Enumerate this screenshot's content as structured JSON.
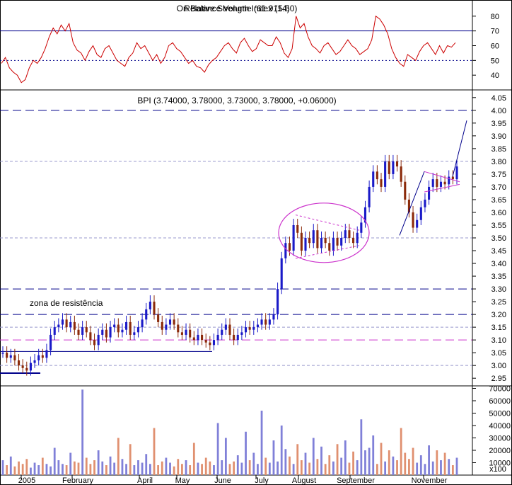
{
  "chart_data": [
    {
      "type": "line",
      "title": "Relative Strength Index (14)",
      "overlay_title": "On Balance Volume (61.915.50)",
      "ylim": [
        30,
        90
      ],
      "yticks": [
        "40",
        "50",
        "60",
        "70",
        "80"
      ],
      "reference_lines": {
        "overbought": 70,
        "oversold": 30,
        "middle": 50
      },
      "series": [
        {
          "values": [
            48,
            52,
            45,
            42,
            40,
            35,
            37,
            45,
            50,
            48,
            52,
            58,
            66,
            72,
            68,
            74,
            70,
            75,
            62,
            57,
            55,
            50,
            56,
            60,
            54,
            52,
            58,
            60,
            55,
            50,
            48,
            46,
            52,
            55,
            62,
            58,
            60,
            55,
            50,
            54,
            48,
            52,
            60,
            62,
            58,
            56,
            52,
            48,
            50,
            46,
            45,
            42,
            47,
            50,
            52,
            56,
            60,
            62,
            58,
            55,
            62,
            65,
            60,
            56,
            58,
            64,
            62,
            60,
            60,
            66,
            62,
            55,
            52,
            58,
            80,
            72,
            75,
            66,
            60,
            58,
            55,
            60,
            62,
            58,
            54,
            56,
            60,
            64,
            60,
            58,
            54,
            56,
            58,
            64,
            80,
            78,
            74,
            68,
            58,
            52,
            48,
            46,
            54,
            52,
            50,
            56,
            60,
            62,
            58,
            54,
            60,
            55,
            60,
            59,
            62
          ]
        }
      ]
    },
    {
      "type": "candlestick",
      "title": "BPI (3.74000, 3.78000, 3.73000, 3.78000, +0.06000)",
      "ylim": [
        2.92,
        4.08
      ],
      "yticks": [
        "2.95",
        "3.00",
        "3.05",
        "3.10",
        "3.15",
        "3.20",
        "3.25",
        "3.30",
        "3.35",
        "3.40",
        "3.45",
        "3.50",
        "3.55",
        "3.60",
        "3.65",
        "3.70",
        "3.75",
        "3.80",
        "3.85",
        "3.90",
        "3.95",
        "4.00",
        "4.05"
      ],
      "annotation": "zona de resistência",
      "colors": {
        "up": "#1a1ac8",
        "down": "#8b2a0a",
        "rsi": "#cc0000",
        "pattern": "#cc33cc",
        "guide": "#00008b"
      },
      "support_resistance_levels": [
        4.0,
        3.3,
        3.2,
        3.1
      ],
      "dotted_levels": [
        3.8,
        3.5,
        3.15,
        3.0
      ],
      "close": [
        3.05,
        3.03,
        3.04,
        3.02,
        3.0,
        2.99,
        2.98,
        3.01,
        3.02,
        3.04,
        3.03,
        3.06,
        3.12,
        3.15,
        3.16,
        3.18,
        3.15,
        3.17,
        3.14,
        3.12,
        3.15,
        3.13,
        3.1,
        3.08,
        3.12,
        3.14,
        3.11,
        3.15,
        3.16,
        3.13,
        3.14,
        3.17,
        3.12,
        3.13,
        3.15,
        3.18,
        3.22,
        3.25,
        3.2,
        3.17,
        3.14,
        3.16,
        3.18,
        3.16,
        3.13,
        3.12,
        3.14,
        3.11,
        3.1,
        3.12,
        3.1,
        3.09,
        3.08,
        3.1,
        3.12,
        3.14,
        3.16,
        3.12,
        3.1,
        3.12,
        3.13,
        3.15,
        3.14,
        3.15,
        3.16,
        3.18,
        3.16,
        3.18,
        3.2,
        3.3,
        3.42,
        3.48,
        3.45,
        3.55,
        3.52,
        3.45,
        3.5,
        3.48,
        3.53,
        3.46,
        3.5,
        3.48,
        3.45,
        3.5,
        3.47,
        3.5,
        3.53,
        3.5,
        3.48,
        3.52,
        3.56,
        3.62,
        3.7,
        3.76,
        3.73,
        3.7,
        3.8,
        3.75,
        3.8,
        3.78,
        3.72,
        3.65,
        3.6,
        3.54,
        3.57,
        3.62,
        3.65,
        3.7,
        3.73,
        3.7,
        3.72,
        3.71,
        3.74,
        3.73,
        3.78
      ],
      "high_low_ranges": [
        [
          3.02,
          3.08
        ],
        [
          2.98,
          3.1
        ]
      ]
    },
    {
      "type": "bar",
      "title": "Volume",
      "ylim": [
        0,
        72000
      ],
      "yticks": [
        "10000",
        "20000",
        "30000",
        "40000",
        "50000",
        "60000",
        "70000"
      ],
      "unit_label": "x100",
      "values": [
        12000,
        8000,
        15000,
        7000,
        11000,
        9000,
        13000,
        6000,
        10000,
        8000,
        14000,
        9000,
        7000,
        22000,
        12000,
        9000,
        8000,
        18000,
        11000,
        10000,
        69000,
        14000,
        9000,
        12000,
        20000,
        11000,
        8000,
        15000,
        10000,
        30000,
        13000,
        9000,
        25000,
        8000,
        12000,
        10000,
        17000,
        9000,
        38000,
        8000,
        11000,
        14000,
        10000,
        7000,
        13000,
        9000,
        12000,
        8000,
        26000,
        10000,
        9000,
        14000,
        11000,
        8000,
        42000,
        12000,
        30000,
        9000,
        11000,
        16000,
        10000,
        35000,
        12000,
        18000,
        9000,
        52000,
        14000,
        10000,
        28000,
        11000,
        40000,
        21000,
        15000,
        9000,
        25000,
        12000,
        18000,
        10000,
        30000,
        13000,
        23000,
        9000,
        16000,
        11000,
        25000,
        14000,
        28000,
        10000,
        19000,
        12000,
        45000,
        20000,
        22000,
        32000,
        9000,
        26000,
        11000,
        20000,
        15000,
        12000,
        38000,
        18000,
        13000,
        22000,
        10000,
        16000,
        9000,
        24000,
        11000,
        20000,
        12000,
        18000,
        13000,
        8000,
        14000
      ]
    }
  ],
  "x_axis": {
    "labels": [
      "2005",
      "February",
      "April",
      "May",
      "June",
      "July",
      "August",
      "September",
      "November"
    ]
  }
}
